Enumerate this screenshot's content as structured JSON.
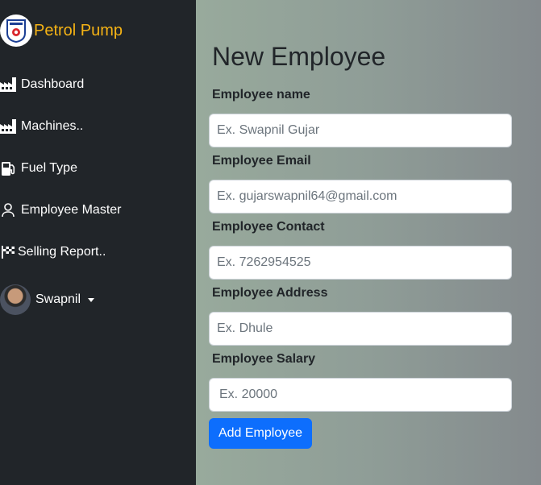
{
  "brand": {
    "name": "Petrol Pump"
  },
  "sidebar": {
    "items": [
      {
        "label": "Dashboard",
        "icon": "factory-icon"
      },
      {
        "label": "Machines..",
        "icon": "factory-icon"
      },
      {
        "label": "Fuel Type",
        "icon": "fuel-pump-icon"
      },
      {
        "label": "Employee Master",
        "icon": "person-icon"
      },
      {
        "label": "Selling Report..",
        "icon": "flag-checkered-icon"
      }
    ],
    "user": {
      "name": "Swapnil"
    }
  },
  "form": {
    "title": "New Employee",
    "fields": [
      {
        "label": "Employee name",
        "placeholder": "Ex. Swapnil Gujar"
      },
      {
        "label": "Employee Email",
        "placeholder": "Ex. gujarswapnil64@gmail.com"
      },
      {
        "label": "Employee Contact",
        "placeholder": "Ex. 7262954525"
      },
      {
        "label": "Employee Address",
        "placeholder": "Ex. Dhule"
      },
      {
        "label": "Employee Salary",
        "placeholder": "Ex. 20000"
      }
    ],
    "submit_label": "Add Employee"
  },
  "colors": {
    "sidebar_bg": "#212529",
    "brand_text": "#f5b315",
    "primary": "#0d6efd"
  }
}
